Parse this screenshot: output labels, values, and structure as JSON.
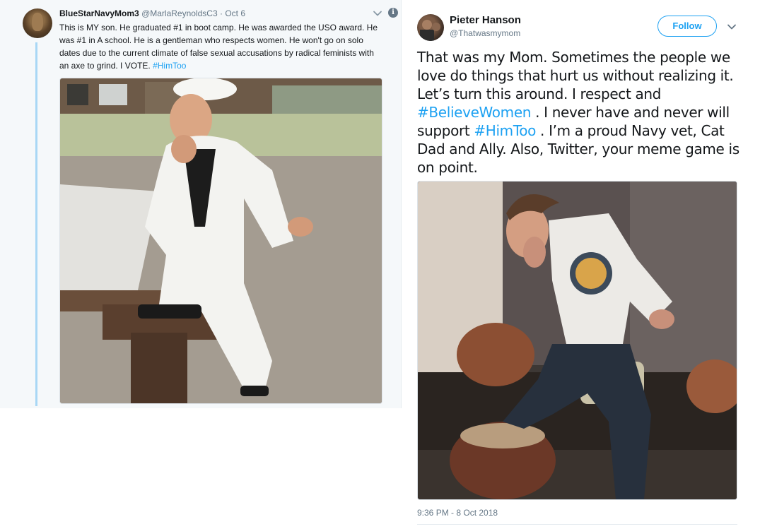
{
  "left_tweet": {
    "display_name": "BlueStarNavyMom3",
    "handle": "@MarlaReynoldsC3",
    "separator": "·",
    "date": "Oct 6",
    "text": "This is MY son. He graduated #1 in boot camp. He was awarded the USO award. He was #1 in A school. He is a gentleman who respects women. He won't go on solo dates due to the current climate of false sexual accusations by radical feminists with an axe to grind. I VOTE.",
    "hashtag": "#HimToo",
    "info_glyph": "i",
    "icons": [
      "chevron-down-icon",
      "info-icon"
    ]
  },
  "right_tweet": {
    "display_name": "Pieter Hanson",
    "handle": "@Thatwasmymom",
    "follow_label": "Follow",
    "text_part1": "That was my Mom. Sometimes the people we love do things that hurt us without realizing it. Let’s turn this around. I respect and ",
    "hashtag1": "#BelieveWomen",
    "text_part2": " . I never have and never will support ",
    "hashtag2": "#HimToo",
    "text_part3": " . I’m a proud Navy vet, Cat Dad and Ally. Also, Twitter, your meme game is on point.",
    "timestamp": "9:36 PM - 8 Oct 2018",
    "icons": [
      "chevron-down-icon"
    ]
  },
  "colors": {
    "link_blue": "#1da1f2",
    "thread_line": "#a8d7f5",
    "secondary_text": "#657786",
    "primary_text": "#14171a",
    "panel_bg": "#f5f8fa"
  }
}
